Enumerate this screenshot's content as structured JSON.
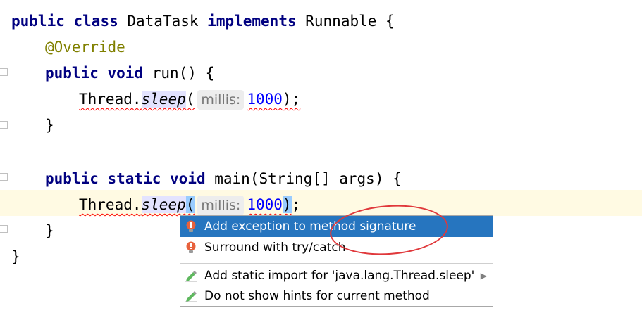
{
  "code": {
    "line1": {
      "kw1": "public",
      "kw2": "class",
      "name": " DataTask ",
      "kw3": "implements",
      "rest": " Runnable {"
    },
    "line2": {
      "annotation": "@Override"
    },
    "line3": {
      "kw1": "public",
      "kw2": "void",
      "rest": " run() {"
    },
    "line4": {
      "receiver": "Thread.",
      "method": "sleep",
      "open": "(",
      "hint": "millis:",
      "arg": "1000",
      "close": ");"
    },
    "line5": {
      "text": "}"
    },
    "line7": {
      "kw1": "public",
      "kw2": "static",
      "kw3": "void",
      "rest": " main(String[] args) {"
    },
    "line8": {
      "receiver": "Thread.",
      "method": "sleep",
      "open": "(",
      "hint": "millis:",
      "arg": "1000",
      "close": ")",
      "semi": ";"
    },
    "line9": {
      "text": "}"
    },
    "line10": {
      "text": "}"
    }
  },
  "popup": {
    "items": [
      {
        "label": "Add exception to method signature",
        "icon": "bulb-error-icon",
        "selected": true
      },
      {
        "label": "Surround with try/catch",
        "icon": "bulb-error-icon",
        "selected": false
      },
      {
        "label": "Add static import for 'java.lang.Thread.sleep'",
        "icon": "pencil-icon",
        "selected": false,
        "submenu": true
      },
      {
        "label": "Do not show hints for current method",
        "icon": "pencil-icon",
        "selected": false
      }
    ]
  },
  "colors": {
    "keyword": "#000080",
    "annotation": "#808000",
    "number": "#0000ff",
    "selection": "#2675bf",
    "error_underline": "#ff0000",
    "highlight_circle": "#e0383b"
  }
}
